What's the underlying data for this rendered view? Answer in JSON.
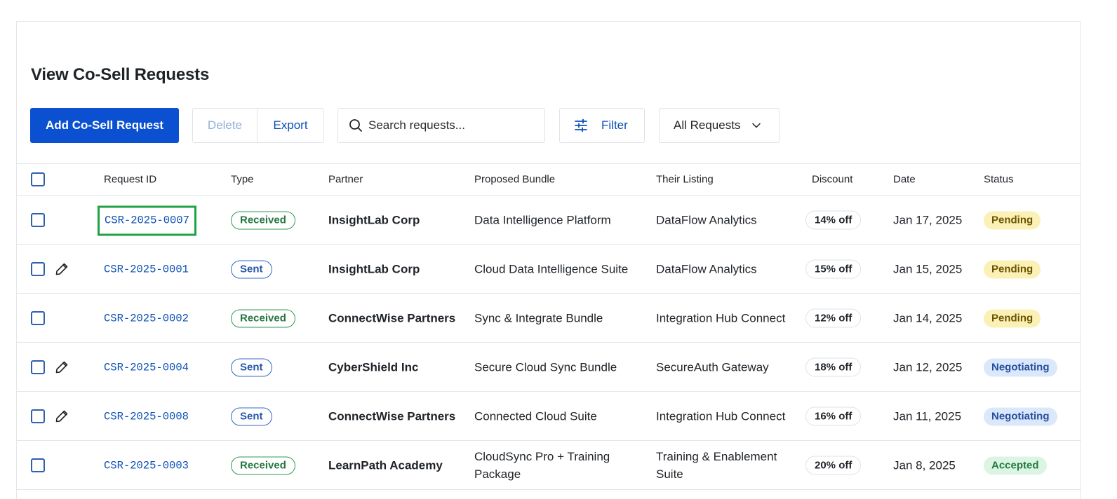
{
  "page": {
    "title": "View Co-Sell Requests"
  },
  "toolbar": {
    "add_label": "Add Co-Sell Request",
    "delete_label": "Delete",
    "export_label": "Export",
    "search_placeholder": "Search requests...",
    "filter_label": "Filter",
    "view_select": {
      "selected": "All Requests"
    }
  },
  "table": {
    "headers": {
      "request_id": "Request ID",
      "type": "Type",
      "partner": "Partner",
      "bundle": "Proposed Bundle",
      "listing": "Their Listing",
      "discount": "Discount",
      "date": "Date",
      "status": "Status"
    },
    "rows": [
      {
        "id": "CSR-2025-0007",
        "type": "Received",
        "partner": "InsightLab Corp",
        "bundle": "Data Intelligence Platform",
        "listing": "DataFlow Analytics",
        "discount": "14% off",
        "date": "Jan 17, 2025",
        "status": "Pending",
        "editable": false,
        "focused": true
      },
      {
        "id": "CSR-2025-0001",
        "type": "Sent",
        "partner": "InsightLab Corp",
        "bundle": "Cloud Data Intelligence Suite",
        "listing": "DataFlow Analytics",
        "discount": "15% off",
        "date": "Jan 15, 2025",
        "status": "Pending",
        "editable": true,
        "focused": false
      },
      {
        "id": "CSR-2025-0002",
        "type": "Received",
        "partner": "ConnectWise Partners",
        "bundle": "Sync & Integrate Bundle",
        "listing": "Integration Hub Connect",
        "discount": "12% off",
        "date": "Jan 14, 2025",
        "status": "Pending",
        "editable": false,
        "focused": false
      },
      {
        "id": "CSR-2025-0004",
        "type": "Sent",
        "partner": "CyberShield Inc",
        "bundle": "Secure Cloud Sync Bundle",
        "listing": "SecureAuth Gateway",
        "discount": "18% off",
        "date": "Jan 12, 2025",
        "status": "Negotiating",
        "editable": true,
        "focused": false
      },
      {
        "id": "CSR-2025-0008",
        "type": "Sent",
        "partner": "ConnectWise Partners",
        "bundle": "Connected Cloud Suite",
        "listing": "Integration Hub Connect",
        "discount": "16% off",
        "date": "Jan 11, 2025",
        "status": "Negotiating",
        "editable": true,
        "focused": false
      },
      {
        "id": "CSR-2025-0003",
        "type": "Received",
        "partner": "LearnPath Academy",
        "bundle": "CloudSync Pro + Training Package",
        "listing": "Training & Enablement Suite",
        "discount": "20% off",
        "date": "Jan 8, 2025",
        "status": "Accepted",
        "editable": false,
        "focused": false
      }
    ]
  },
  "colors": {
    "primary": "#0b50d0",
    "link": "#0b4fb7",
    "focus_outline": "#1fa144",
    "pending_bg": "#fbf1b6",
    "negotiating_bg": "#dbe8fb",
    "accepted_bg": "#dcf5e2"
  },
  "icons": {
    "search": "search-icon",
    "filter": "sliders-icon",
    "dropdown": "chevron-down-icon",
    "edit": "pencil-icon"
  }
}
